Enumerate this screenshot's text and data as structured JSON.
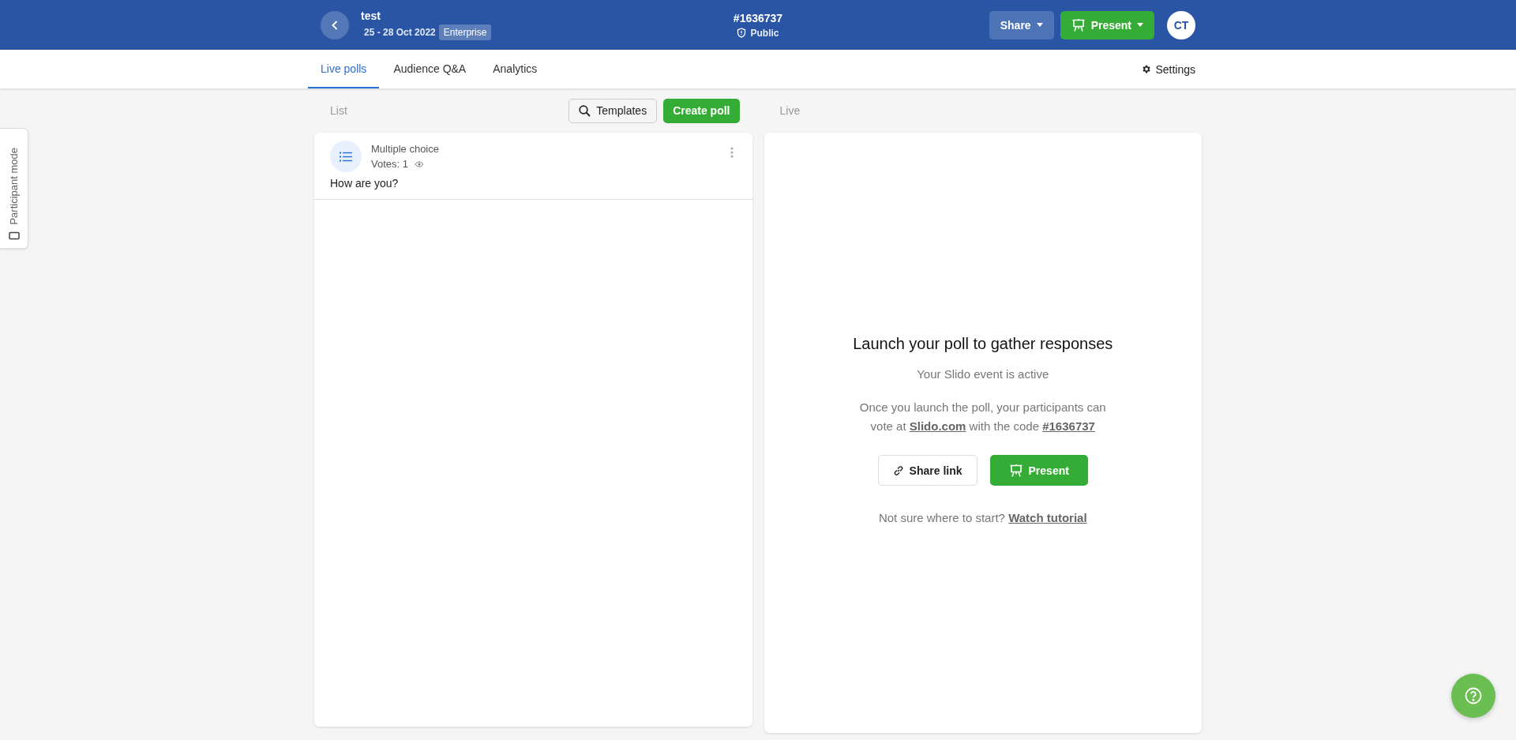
{
  "header": {
    "event_title": "test",
    "dates": "25 - 28 Oct 2022",
    "plan_badge": "Enterprise",
    "event_code": "#1636737",
    "privacy": "Public",
    "share_button": "Share",
    "present_button": "Present",
    "avatar_initials": "CT"
  },
  "tabs": [
    {
      "label": "Live polls",
      "selected": true
    },
    {
      "label": "Audience Q&A",
      "selected": false
    },
    {
      "label": "Analytics",
      "selected": false
    }
  ],
  "settings": "Settings",
  "list": {
    "heading": "List",
    "templates_button": "Templates",
    "create_button": "Create poll",
    "polls": [
      {
        "type": "Multiple choice",
        "votes": "Votes: 1",
        "question": "How are you?"
      }
    ]
  },
  "live": {
    "heading": "Live",
    "title": "Launch your poll to gather responses",
    "status": "Your Slido event is active",
    "instructions": [
      {
        "kind": "text",
        "text": "Once you launch the poll, your participants can vote at "
      },
      {
        "kind": "link",
        "text": "Slido.com"
      },
      {
        "kind": "text",
        "text": " with the code "
      },
      {
        "kind": "link",
        "text": "#1636737"
      }
    ],
    "share_link_button": "Share link",
    "present_button": "Present",
    "help_text": "Not sure where to start?",
    "help_link": "Watch tutorial"
  },
  "participant_mode": "Participant mode"
}
